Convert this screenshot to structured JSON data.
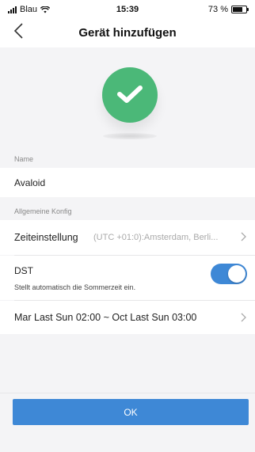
{
  "status_bar": {
    "carrier": "Blau",
    "time": "15:39",
    "battery": "73 %",
    "battery_level": 0.73,
    "icons": [
      "signal-icon",
      "wifi-icon",
      "battery-icon"
    ]
  },
  "nav": {
    "title": "Gerät hinzufügen",
    "back_icon": "chevron-left-icon"
  },
  "hero": {
    "icon": "success-check-icon",
    "color": "#4bb878"
  },
  "name_section": {
    "label": "Name",
    "value": "Avaloid"
  },
  "general_section": {
    "label": "Allgemeine Konfig",
    "time_setting": {
      "label": "Zeiteinstellung",
      "value": "(UTC +01:0):Amsterdam, Berli..."
    },
    "dst": {
      "title": "DST",
      "subtitle": "Stellt automatisch die Sommerzeit ein.",
      "enabled": true
    },
    "dst_range": {
      "value": "Mar Last Sun 02:00 ~ Oct Last Sun 03:00"
    }
  },
  "footer": {
    "ok_label": "OK"
  },
  "colors": {
    "accent": "#3e88d6",
    "success": "#4bb878",
    "background": "#f4f4f6"
  }
}
